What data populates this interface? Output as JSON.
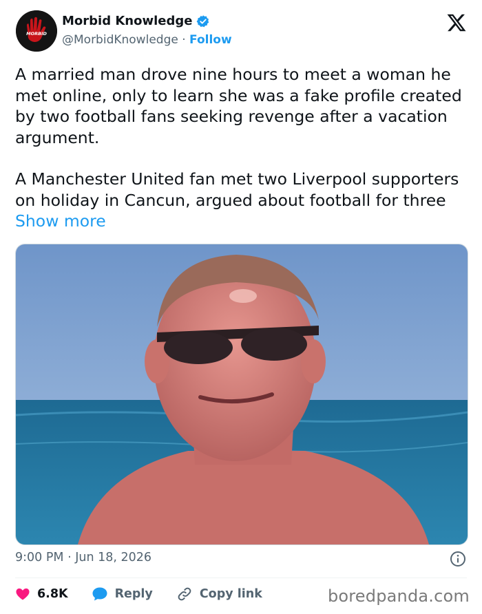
{
  "author": {
    "display_name": "Morbid Knowledge",
    "handle": "@MorbidKnowledge",
    "separator": "·",
    "follow_label": "Follow",
    "verified": true,
    "avatar_text": "MORBID",
    "brand_color": "#1d9bf0"
  },
  "tweet": {
    "paragraph_1": "A married man drove nine hours to meet a woman he met online, only to learn she was a fake profile created by two football fans seeking revenge after a vacation argument.",
    "paragraph_2": "A Manchester United fan met two Liverpool supporters on holiday in Cancun, argued about football for three",
    "show_more_label": "Show more",
    "timestamp": "9:00 PM · Jun 18, 2026"
  },
  "actions": {
    "like_count": "6.8K",
    "reply_label": "Reply",
    "copy_link_label": "Copy link",
    "like_color": "#f91880",
    "reply_color": "#1d9bf0"
  },
  "icons": [
    "x-logo-icon",
    "verified-badge-icon",
    "info-icon",
    "heart-icon",
    "reply-bubble-icon",
    "link-icon"
  ],
  "watermark": "boredpanda.com"
}
